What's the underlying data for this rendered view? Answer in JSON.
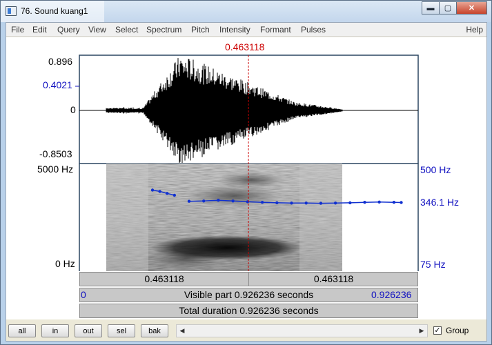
{
  "window": {
    "title": "76. Sound kuang1",
    "minimize": "▬",
    "maximize": "▢",
    "close": "✕"
  },
  "menu": [
    "File",
    "Edit",
    "Query",
    "View",
    "Select",
    "Spectrum",
    "Pitch",
    "Intensity",
    "Formant",
    "Pulses"
  ],
  "menu_help": "Help",
  "cursor": {
    "time": "0.463118"
  },
  "waveform": {
    "max_label": "0.896",
    "mid_label": "0.4021",
    "zero_label": "0",
    "min_label": "-0.8503"
  },
  "spectrogram": {
    "top_freq": "5000 Hz",
    "bottom_freq": "0 Hz",
    "pitch_top": "500 Hz",
    "pitch_current": "346.1 Hz",
    "pitch_bottom": "75 Hz",
    "pitch_contour": [
      {
        "t": 0.2,
        "hz": 395
      },
      {
        "t": 0.22,
        "hz": 390
      },
      {
        "t": 0.24,
        "hz": 382
      },
      {
        "t": 0.26,
        "hz": 375
      },
      {
        "t": 0.3,
        "hz": 351
      },
      {
        "t": 0.34,
        "hz": 352
      },
      {
        "t": 0.38,
        "hz": 355
      },
      {
        "t": 0.42,
        "hz": 352
      },
      {
        "t": 0.46,
        "hz": 349
      },
      {
        "t": 0.5,
        "hz": 347
      },
      {
        "t": 0.54,
        "hz": 345
      },
      {
        "t": 0.58,
        "hz": 344
      },
      {
        "t": 0.62,
        "hz": 344
      },
      {
        "t": 0.66,
        "hz": 343
      },
      {
        "t": 0.7,
        "hz": 344
      },
      {
        "t": 0.74,
        "hz": 345
      },
      {
        "t": 0.78,
        "hz": 347
      },
      {
        "t": 0.82,
        "hz": 348
      },
      {
        "t": 0.86,
        "hz": 347
      },
      {
        "t": 0.88,
        "hz": 346
      }
    ]
  },
  "time_bar": {
    "left_segment": "0.463118",
    "right_segment": "0.463118",
    "visible_start": "0",
    "visible_text": "Visible part 0.926236 seconds",
    "visible_end": "0.926236",
    "total_text": "Total duration 0.926236 seconds"
  },
  "buttons": {
    "all": "all",
    "in": "in",
    "out": "out",
    "sel": "sel",
    "bak": "bak"
  },
  "group": {
    "label": "Group",
    "checked": "✓"
  },
  "scroll": {
    "left": "◀",
    "right": "▶"
  }
}
